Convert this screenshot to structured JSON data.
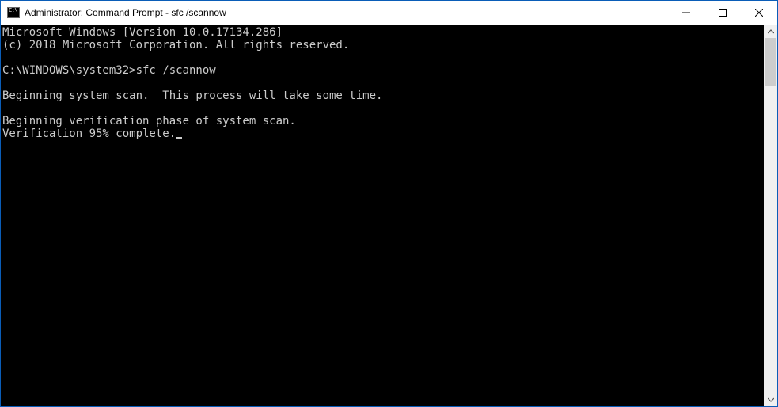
{
  "window": {
    "title": "Administrator: Command Prompt - sfc  /scannow"
  },
  "console": {
    "colors": {
      "bg": "#000000",
      "fg": "#cccccc"
    },
    "lines": {
      "l0": "Microsoft Windows [Version 10.0.17134.286]",
      "l1": "(c) 2018 Microsoft Corporation. All rights reserved.",
      "l2": "",
      "prompt_path": "C:\\WINDOWS\\system32>",
      "command": "sfc /scannow",
      "l4": "",
      "l5": "Beginning system scan.  This process will take some time.",
      "l6": "",
      "l7": "Beginning verification phase of system scan.",
      "l8": "Verification 95% complete."
    }
  }
}
